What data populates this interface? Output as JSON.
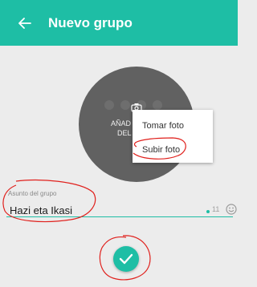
{
  "header": {
    "title": "Nuevo grupo",
    "back_icon": "arrow-left-icon"
  },
  "avatar": {
    "label_line1": "AÑAD",
    "label_line2": "DEL",
    "camera_icon": "camera-icon"
  },
  "photo_menu": {
    "items": [
      {
        "label": "Tomar foto"
      },
      {
        "label": "Subir foto"
      }
    ]
  },
  "subject_field": {
    "label": "Asunto del grupo",
    "value": "Hazi eta Ikasi",
    "remaining_chars": "11",
    "emoji_icon": "emoji-icon"
  },
  "confirm_button": {
    "icon": "check-icon"
  },
  "colors": {
    "accent": "#1ebea5",
    "annotation": "#e0201c",
    "background": "#ececec",
    "avatar": "#616161"
  }
}
